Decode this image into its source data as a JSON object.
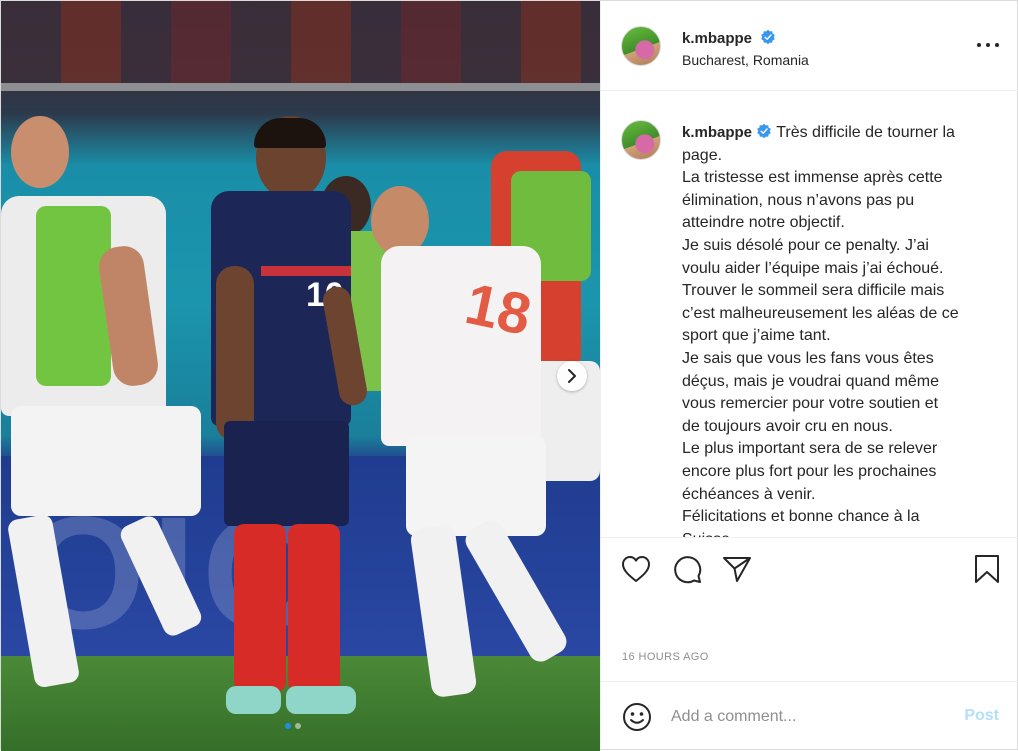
{
  "post": {
    "username": "k.mbappe",
    "location": "Bucharest, Romania",
    "caption_lines": [
      "Très difficile de tourner la",
      "page.",
      "La tristesse est immense après cette",
      "élimination, nous n’avons pas pu",
      "atteindre notre objectif.",
      "Je suis désolé pour ce penalty. J’ai",
      "voulu aider l’équipe mais j’ai échoué.",
      "Trouver le sommeil sera difficile mais",
      "c’est malheureusement les aléas de ce",
      "sport que j’aime tant.",
      "Je sais que vous les fans vous êtes",
      "déçus, mais je voudrai quand même",
      "vous remercier pour votre soutien et",
      "de toujours avoir cru en nous.",
      "Le plus important sera de se relever",
      "encore plus fort pour les prochaines",
      "échéances à venir.",
      "Félicitations et bonne chance à la",
      "Suisse"
    ],
    "timestamp": "16 HOURS AGO",
    "comment_placeholder": "Add a comment...",
    "post_label": "Post",
    "carousel": {
      "slides": 2,
      "active": 1
    }
  },
  "icons": {
    "verified": "verified-badge-icon",
    "more": "more-options-icon",
    "like": "heart-icon",
    "comment": "comment-bubble-icon",
    "share": "paper-plane-icon",
    "save": "bookmark-icon",
    "emoji": "emoji-smile-icon",
    "next": "chevron-right-icon"
  },
  "colors": {
    "text": "#262626",
    "muted": "#8e8e8e",
    "verified": "#3897f0",
    "post_disabled": "#b2dffc",
    "border": "#dbdbdb"
  },
  "photo": {
    "jersey_number_left": "10",
    "jersey_number_right": "18"
  }
}
